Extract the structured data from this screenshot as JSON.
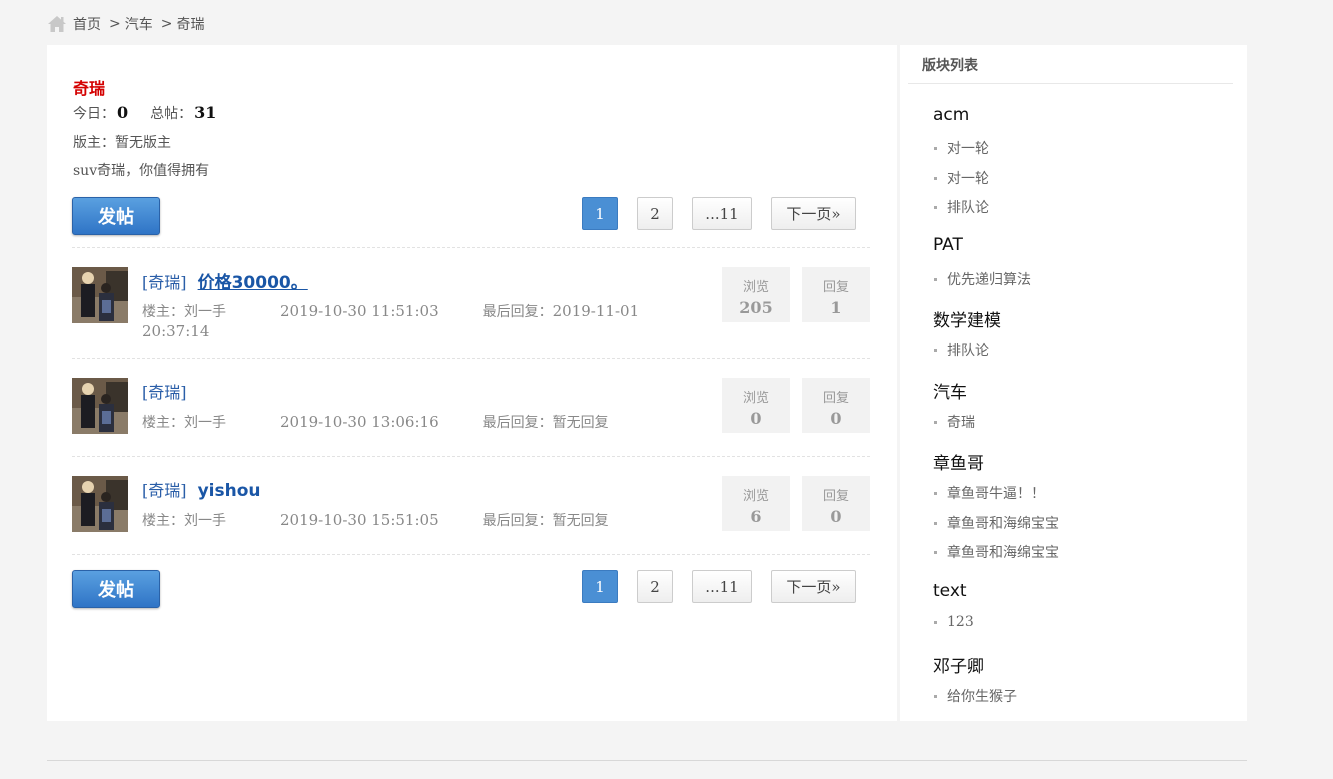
{
  "breadcrumb": {
    "home": "首页",
    "sep1": ">",
    "level1": "汽车",
    "sep2": ">",
    "level2": "奇瑞"
  },
  "forum": {
    "name": "奇瑞",
    "today_label": "今日：",
    "today": "0",
    "total_label": "总帖：",
    "total": "31",
    "moderator": "版主：暂无版主",
    "description": "suv奇瑞，你值得拥有"
  },
  "actions": {
    "post_label": "发帖"
  },
  "pager": {
    "p1": "1",
    "p2": "2",
    "last": "...11",
    "next": "下一页»"
  },
  "threads": [
    {
      "tag": "[奇瑞]",
      "title": "价格30000。",
      "author": "楼主：刘一手",
      "time": "2019-10-30 11:51:03",
      "last_label": "最后回复：",
      "last_reply": "2019-11-01 20:37:14",
      "views_label": "浏览",
      "views": "205",
      "replies_label": "回复",
      "replies": "1"
    },
    {
      "tag": "[奇瑞]",
      "title": "",
      "author": "楼主：刘一手",
      "time": "2019-10-30 13:06:16",
      "last_label": "最后回复：",
      "last_reply": "暂无回复",
      "views_label": "浏览",
      "views": "0",
      "replies_label": "回复",
      "replies": "0"
    },
    {
      "tag": "[奇瑞]",
      "title": "yishou",
      "author": "楼主：刘一手",
      "time": "2019-10-30 15:51:05",
      "last_label": "最后回复：",
      "last_reply": "暂无回复",
      "views_label": "浏览",
      "views": "6",
      "replies_label": "回复",
      "replies": "0"
    }
  ],
  "sidebar": {
    "title": "版块列表",
    "categories": [
      {
        "name": "acm",
        "subs": [
          "对一轮",
          "对一轮",
          "排队论"
        ]
      },
      {
        "name": "PAT",
        "subs": [
          "优先递归算法"
        ]
      },
      {
        "name": "数学建模",
        "subs": [
          "排队论"
        ]
      },
      {
        "name": "汽车",
        "subs": [
          "奇瑞"
        ]
      },
      {
        "name": "章鱼哥",
        "subs": [
          "章鱼哥牛逼！！",
          "章鱼哥和海绵宝宝",
          "章鱼哥和海绵宝宝"
        ]
      },
      {
        "name": "text",
        "subs": [
          "123"
        ]
      },
      {
        "name": "邓子卿",
        "subs": [
          "给你生猴子"
        ]
      }
    ]
  },
  "colors": {
    "accent": "#4a8fd4",
    "forum_name": "#d40000",
    "link": "#1a56a6"
  }
}
